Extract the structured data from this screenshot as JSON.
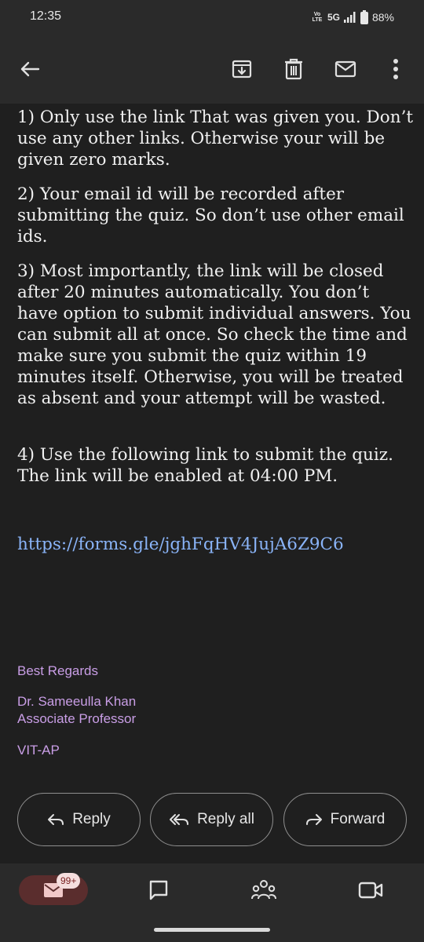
{
  "status_bar": {
    "time": "12:35",
    "volte": "Vo LTE",
    "network": "5G",
    "battery": "88%"
  },
  "toolbar": {
    "back_icon": "arrow-left-icon",
    "archive_icon": "archive-icon",
    "delete_icon": "trash-icon",
    "mark_unread_icon": "mail-icon",
    "more_icon": "more-vertical-icon"
  },
  "email": {
    "paragraphs": [
      "1)  Only use the link That was given you. Don’t use any other links. Otherwise your will be given zero marks.",
      "2)  Your email id will be recorded after submitting the quiz. So don’t use other email ids.",
      "3)  Most importantly, the link will be closed after 20 minutes automatically. You don’t have option to submit individual answers. You can submit all at once. So check the time and make sure you submit the quiz within 19 minutes itself. Otherwise, you will be treated as absent and your attempt will be wasted.",
      "4)  Use the following link to submit the quiz. The link will be enabled at 04:00 PM."
    ],
    "link": "https://forms.gle/jghFqHV4JujA6Z9C6",
    "signature": {
      "greeting": "Best Regards",
      "name": "Dr. Sameeulla Khan",
      "title": "Associate Professor",
      "org": "VIT-AP"
    }
  },
  "actions": {
    "reply": "Reply",
    "reply_all": "Reply all",
    "forward": "Forward"
  },
  "bottom_nav": {
    "mail_badge": "99+",
    "items": [
      "mail-icon",
      "chat-icon",
      "spaces-icon",
      "meet-icon"
    ]
  },
  "colors": {
    "link": "#8ab4f8",
    "signature": "#c99ee6",
    "background": "#1f1f1f"
  }
}
